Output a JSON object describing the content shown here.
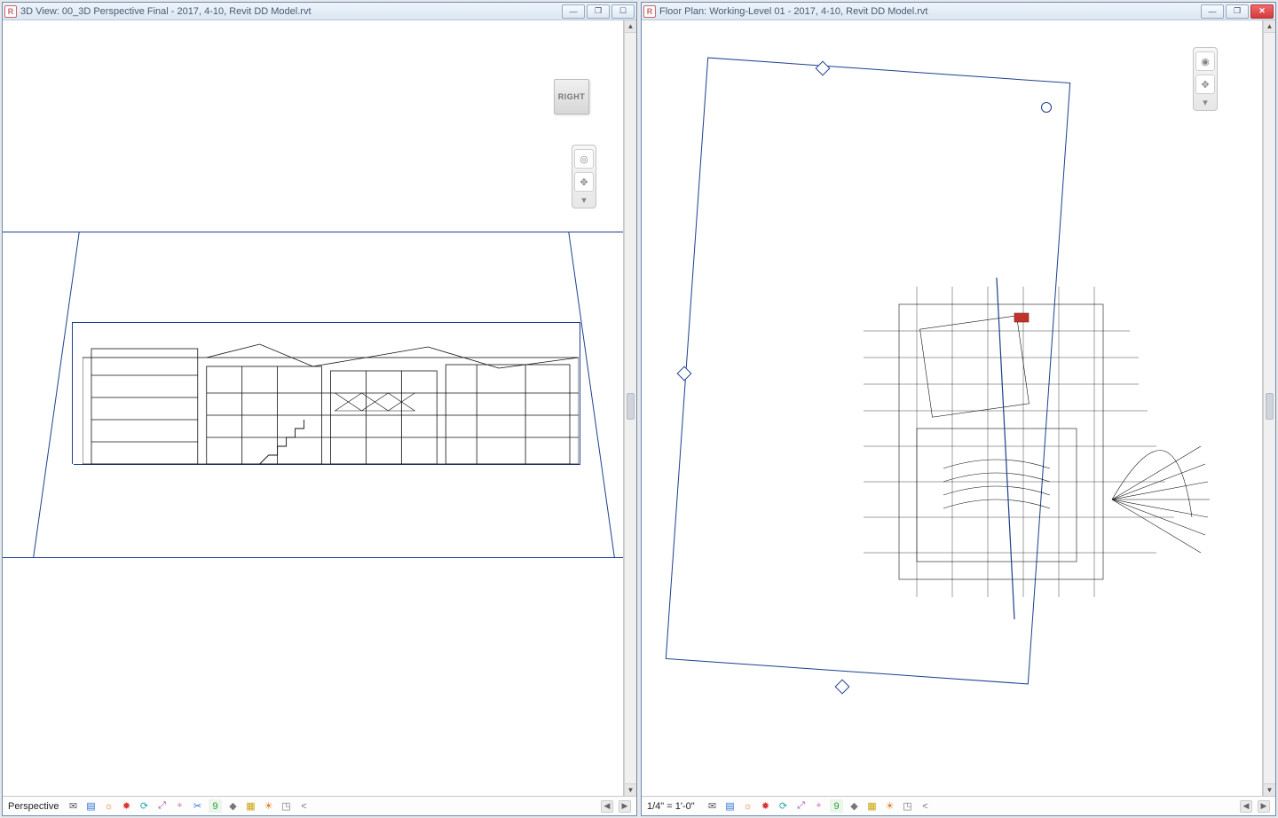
{
  "left_pane": {
    "title": "3D View: 00_3D Perspective Final - 2017, 4-10, Revit DD Model.rvt",
    "mode": "Perspective",
    "viewcube_face": "RIGHT"
  },
  "right_pane": {
    "title": "Floor Plan: Working-Level 01 - 2017, 4-10, Revit DD Model.rvt",
    "scale": "1/4\" = 1'-0\""
  },
  "win_btn_glyphs": {
    "minimize": "—",
    "restore": "❐",
    "maximize": "☐",
    "close": "✕"
  },
  "nav_icons": {
    "wheel": "◎",
    "pan": "✥",
    "zoom": "⤢",
    "chev": "▾",
    "home": "⌂",
    "target": "◉"
  },
  "arrows": {
    "up": "▲",
    "down": "▼",
    "left": "◀",
    "right": "▶"
  },
  "vc_tool_icons": [
    "✉",
    "▤",
    "☼",
    "✹",
    "⟳",
    "⤢",
    "⌖",
    "✂",
    "9",
    "◆",
    "▦",
    "☀",
    "◳",
    "<"
  ]
}
